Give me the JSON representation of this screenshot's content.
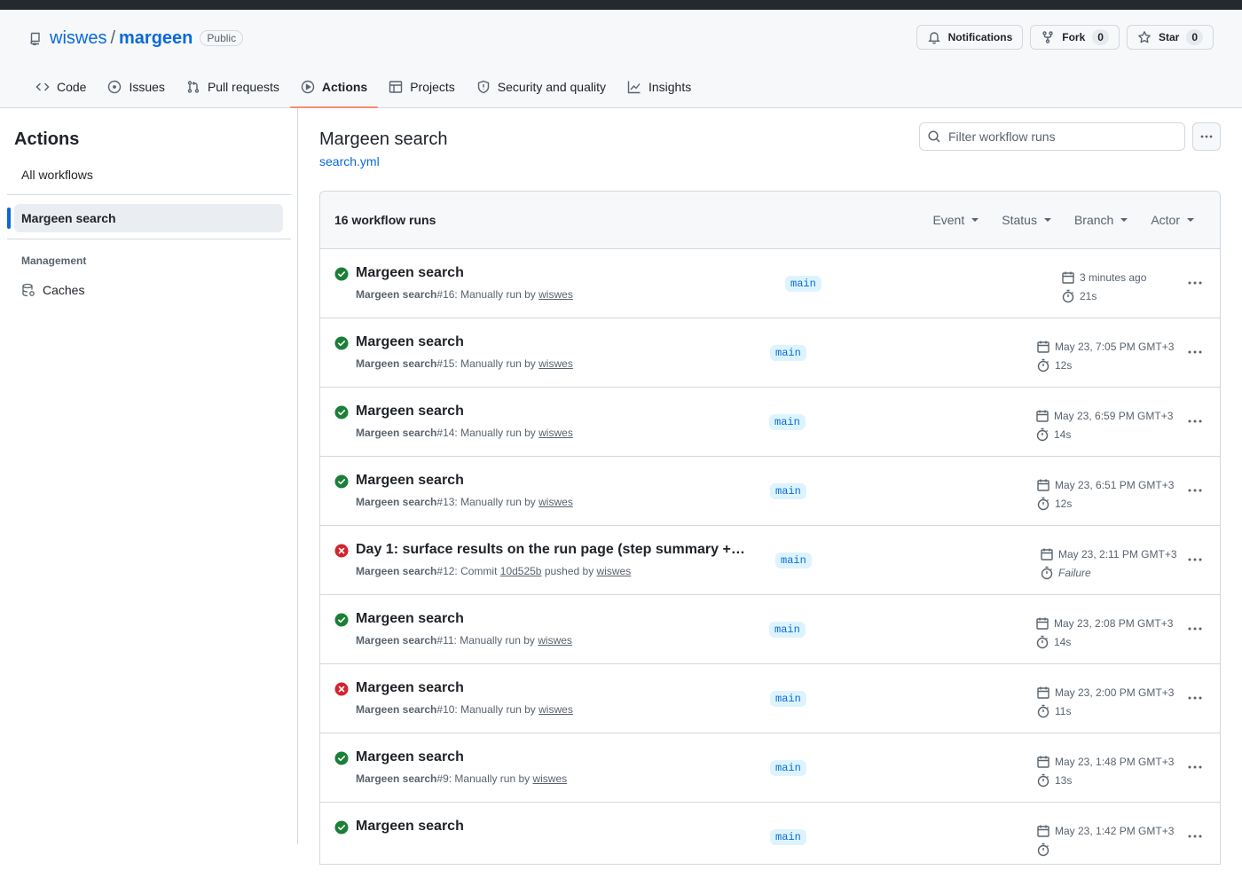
{
  "repo": {
    "owner": "wiswes",
    "separator": "/",
    "name": "margeen",
    "visibility": "Public"
  },
  "header_actions": {
    "notifications_label": "Notifications",
    "fork_label": "Fork",
    "fork_count": "0",
    "star_label": "Star",
    "star_count": "0"
  },
  "tabs": [
    {
      "label": "Code",
      "icon": "code-icon"
    },
    {
      "label": "Issues",
      "icon": "issue-opened-icon"
    },
    {
      "label": "Pull requests",
      "icon": "git-pull-request-icon"
    },
    {
      "label": "Actions",
      "icon": "play-icon",
      "active": true
    },
    {
      "label": "Projects",
      "icon": "table-icon"
    },
    {
      "label": "Security and quality",
      "icon": "shield-icon"
    },
    {
      "label": "Insights",
      "icon": "graph-icon"
    }
  ],
  "sidebar": {
    "title": "Actions",
    "all_workflows": "All workflows",
    "selected_workflow": "Margeen search",
    "management_heading": "Management",
    "caches": "Caches"
  },
  "workflow": {
    "title": "Margeen search",
    "file": "search.yml"
  },
  "filter": {
    "placeholder": "Filter workflow runs"
  },
  "runs_header": {
    "count_label": "16 workflow runs",
    "filters": [
      "Event",
      "Status",
      "Branch",
      "Actor"
    ]
  },
  "colors": {
    "success": "#1a7f37",
    "failure": "#d1242f",
    "accent": "#0969da",
    "tab_underline": "#fd8c73"
  },
  "runs": [
    {
      "status": "success",
      "title": "Margeen search",
      "workflow": "Margeen search",
      "number": "#16",
      "trigger": ": Manually run by ",
      "commit": "",
      "actor": "wiswes",
      "branch": "main",
      "time": "3 minutes ago",
      "duration": "21s"
    },
    {
      "status": "success",
      "title": "Margeen search",
      "workflow": "Margeen search",
      "number": "#15",
      "trigger": ": Manually run by ",
      "commit": "",
      "actor": "wiswes",
      "branch": "main",
      "time": "May 23, 7:05 PM GMT+3",
      "duration": "12s"
    },
    {
      "status": "success",
      "title": "Margeen search",
      "workflow": "Margeen search",
      "number": "#14",
      "trigger": ": Manually run by ",
      "commit": "",
      "actor": "wiswes",
      "branch": "main",
      "time": "May 23, 6:59 PM GMT+3",
      "duration": "14s"
    },
    {
      "status": "success",
      "title": "Margeen search",
      "workflow": "Margeen search",
      "number": "#13",
      "trigger": ": Manually run by ",
      "commit": "",
      "actor": "wiswes",
      "branch": "main",
      "time": "May 23, 6:51 PM GMT+3",
      "duration": "12s"
    },
    {
      "status": "failure",
      "title": "Day 1: surface results on the run page (step summary + ...",
      "workflow": "Margeen search",
      "number": "#12",
      "trigger": ": Commit ",
      "commit": "10d525b",
      "actor": "wiswes",
      "branch": "main",
      "time": "May 23, 2:11 PM GMT+3",
      "duration": "Failure"
    },
    {
      "status": "success",
      "title": "Margeen search",
      "workflow": "Margeen search",
      "number": "#11",
      "trigger": ": Manually run by ",
      "commit": "",
      "actor": "wiswes",
      "branch": "main",
      "time": "May 23, 2:08 PM GMT+3",
      "duration": "14s"
    },
    {
      "status": "failure",
      "title": "Margeen search",
      "workflow": "Margeen search",
      "number": "#10",
      "trigger": ": Manually run by ",
      "commit": "",
      "actor": "wiswes",
      "branch": "main",
      "time": "May 23, 2:00 PM GMT+3",
      "duration": "11s"
    },
    {
      "status": "success",
      "title": "Margeen search",
      "workflow": "Margeen search",
      "number": "#9",
      "trigger": ": Manually run by ",
      "commit": "",
      "actor": "wiswes",
      "branch": "main",
      "time": "May 23, 1:48 PM GMT+3",
      "duration": "13s"
    },
    {
      "status": "success",
      "title": "Margeen search",
      "workflow": "Margeen search",
      "number": "",
      "trigger": "",
      "commit": "",
      "actor": "",
      "branch": "main",
      "time": "May 23, 1:42 PM GMT+3",
      "duration": ""
    }
  ]
}
